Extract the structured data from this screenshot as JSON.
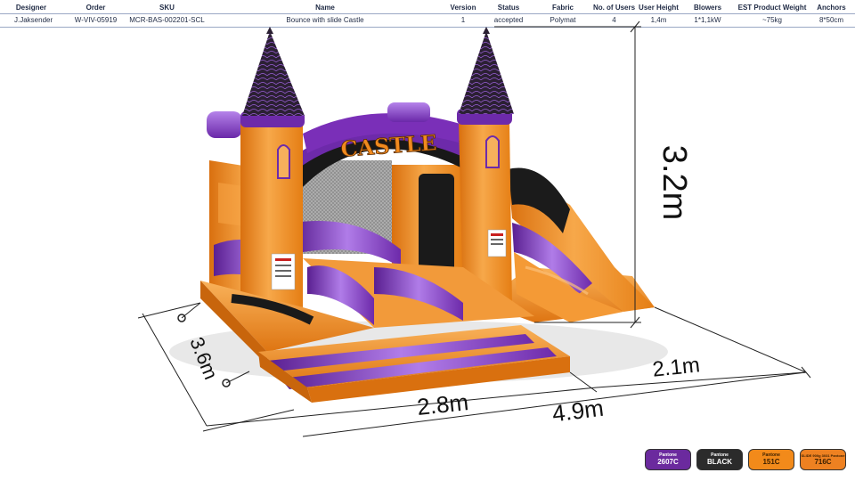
{
  "spec_table": {
    "headers": {
      "designer": "Designer",
      "order": "Order",
      "sku": "SKU",
      "name": "Name",
      "version": "Version",
      "status": "Status",
      "fabric": "Fabric",
      "users": "No. of Users",
      "user_height": "User Height",
      "blowers": "Blowers",
      "weight": "EST Product Weight",
      "anchors": "Anchors"
    },
    "row": {
      "designer": "J.Jaksender",
      "order": "W-VIV-05919",
      "sku": "MCR-BAS-002201-SCL",
      "name": "Bounce with slide Castle",
      "version": "1",
      "status": "accepted",
      "fabric": "Polymat",
      "users": "4",
      "user_height": "1,4m",
      "blowers": "1*1,1kW",
      "weight": "~75kg",
      "anchors": "8*50cm"
    }
  },
  "product": {
    "banner_text": "CASTLE"
  },
  "dimensions": {
    "height": "3.2m",
    "depth": "3.6m",
    "bounce_width": "2.8m",
    "slide_width": "2.1m",
    "total_width": "4.9m"
  },
  "colors": {
    "orange": "#f08a1e",
    "orange_light": "#f7a84a",
    "orange_dark": "#c8650c",
    "purple": "#7a2fb8",
    "purple_light": "#a56be0",
    "black": "#1c1c1c",
    "dim_line": "#222222"
  },
  "swatches": [
    {
      "brand": "Pantone",
      "code": "2607C",
      "bg": "#6b2a9e",
      "fg": "#ffffff"
    },
    {
      "brand": "Pantone",
      "code": "BLACK",
      "bg": "#2b2b2b",
      "fg": "#ffffff"
    },
    {
      "brand": "Pantone",
      "code": "151C",
      "bg": "#f28a1a",
      "fg": "#3a1f00"
    },
    {
      "brand": "SLIDE 900g 3031 Pantone",
      "code": "716C",
      "bg": "#ee8121",
      "fg": "#3a1f00"
    }
  ]
}
